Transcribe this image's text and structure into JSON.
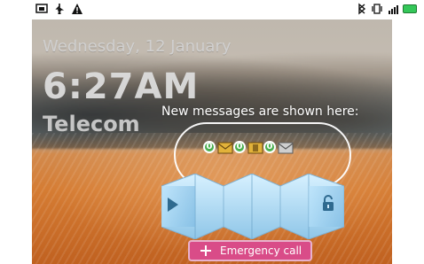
{
  "status_bar": {
    "left_icons": [
      "screenshot-icon",
      "usb-icon",
      "warning-icon"
    ],
    "right_icons": [
      "bluetooth-icon",
      "vibrate-icon",
      "signal-icon",
      "battery-icon"
    ],
    "accent_battery": "#34c759"
  },
  "lockscreen": {
    "date": "Wednesday, 12 January",
    "time": "6:27AM",
    "carrier": "Telecom",
    "hint": "New messages are shown here:",
    "notifications": [
      {
        "icon": "email-icon",
        "count": "0"
      },
      {
        "icon": "voicemail-icon",
        "count": "0"
      },
      {
        "icon": "sms-icon",
        "count": "0"
      }
    ],
    "emergency_label": "Emergency call",
    "accent_emergency": "#d94c88"
  }
}
